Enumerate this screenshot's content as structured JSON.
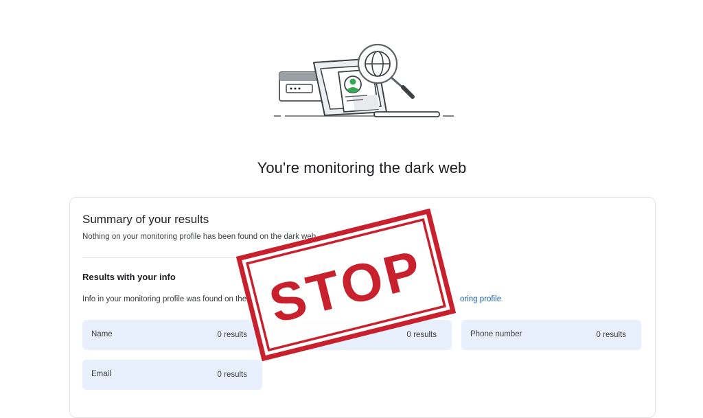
{
  "page": {
    "title": "You're monitoring the dark web"
  },
  "summary": {
    "title": "Summary of your results",
    "subtitle": "Nothing on your monitoring profile has been found on the dark web."
  },
  "results_section": {
    "title": "Results with your info",
    "description": "Info in your monitoring profile was found on the",
    "link_text": "oring profile"
  },
  "results": [
    {
      "label": "Name",
      "count": "0 results"
    },
    {
      "label": "",
      "count": "0 results"
    },
    {
      "label": "Phone number",
      "count": "0 results"
    },
    {
      "label": "Email",
      "count": "0 results"
    }
  ],
  "stamp": {
    "text": "STOP",
    "color": "#c8202c"
  },
  "illustration": {
    "icons": [
      "browser-window-icon",
      "laptop-icon",
      "profile-avatar-icon",
      "magnifier-globe-icon"
    ],
    "avatar_color": "#34a853"
  },
  "colors": {
    "tile_background": "#e8f0fe",
    "link": "#1a5fb4"
  }
}
